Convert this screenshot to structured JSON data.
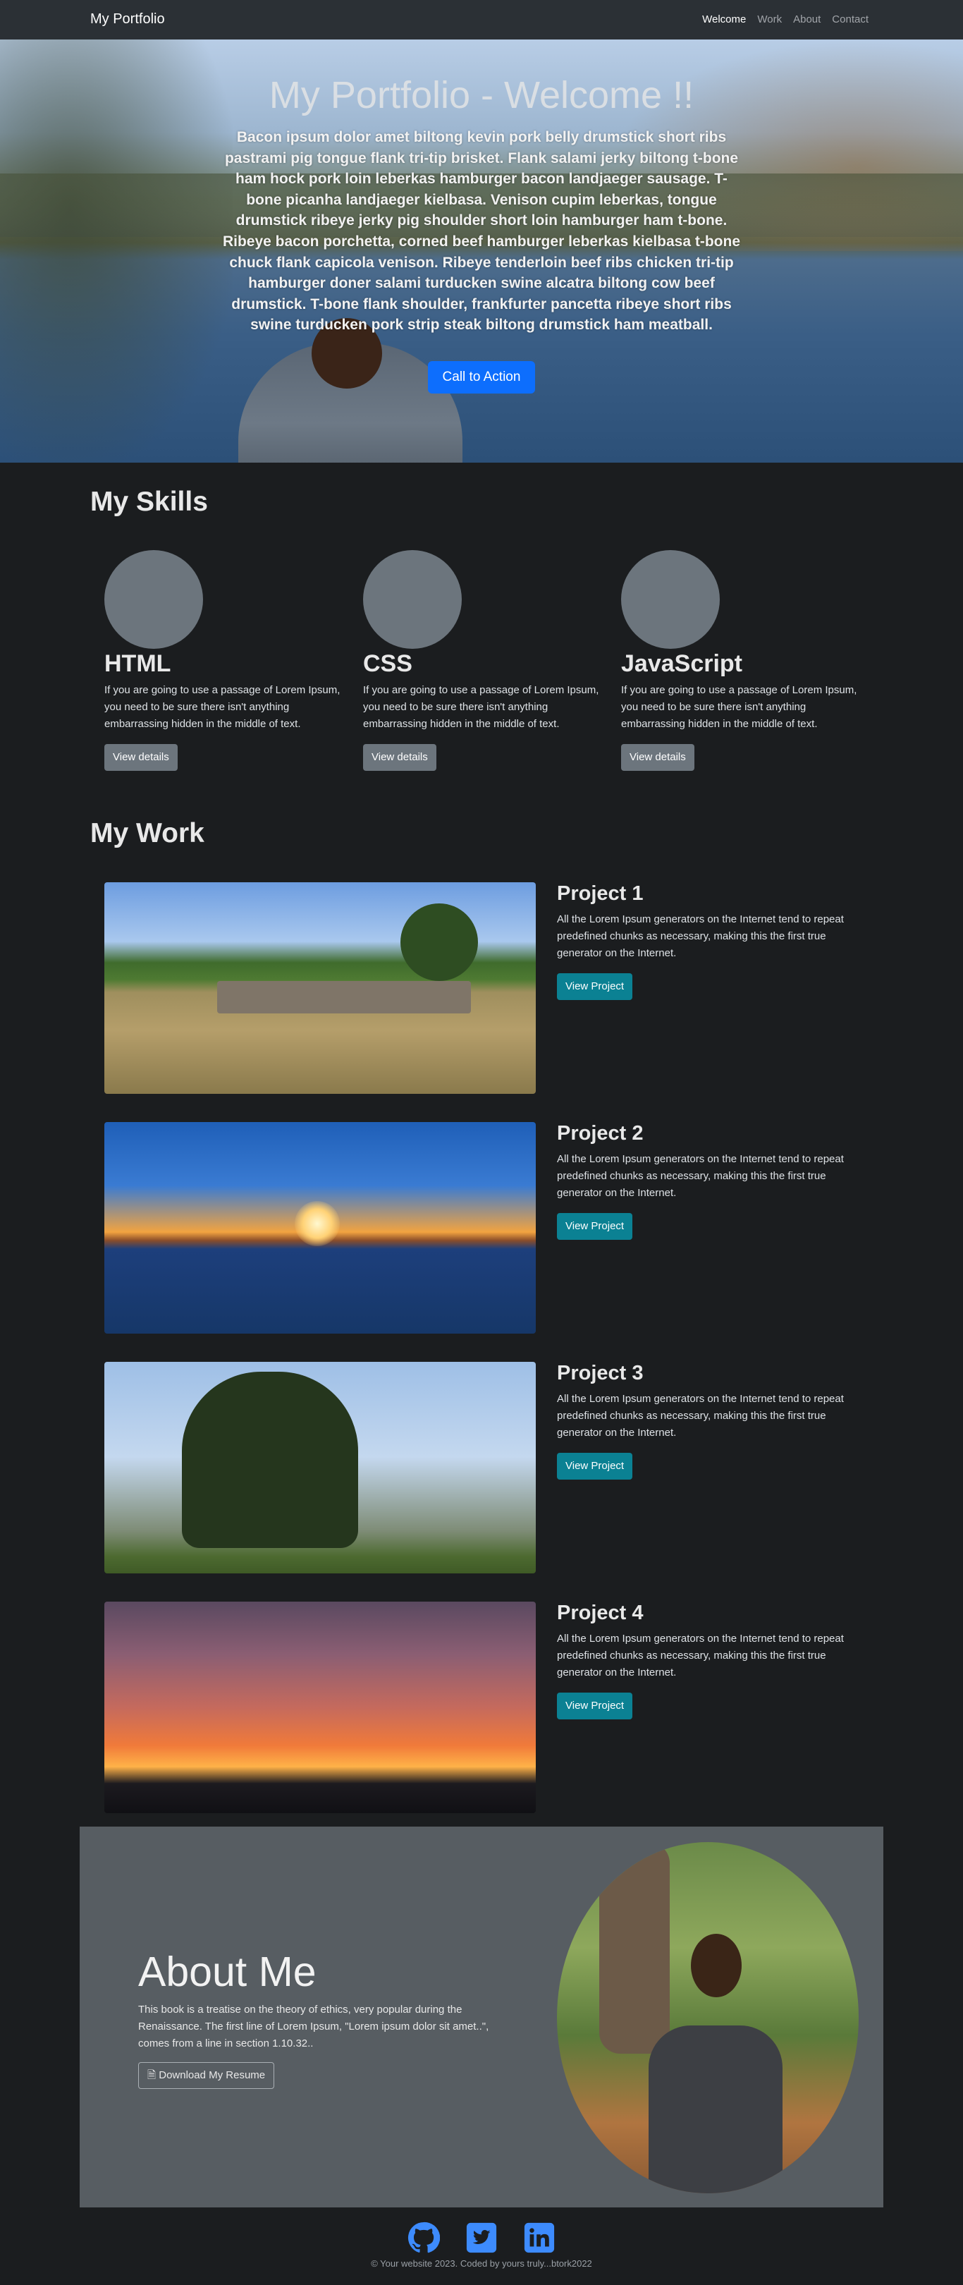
{
  "nav": {
    "brand": "My Portfolio",
    "links": [
      {
        "label": "Welcome",
        "active": true
      },
      {
        "label": "Work",
        "active": false
      },
      {
        "label": "About",
        "active": false
      },
      {
        "label": "Contact",
        "active": false
      }
    ]
  },
  "hero": {
    "title": "My Portfolio - Welcome !!",
    "text": "Bacon ipsum dolor amet biltong kevin pork belly drumstick short ribs pastrami pig tongue flank tri-tip brisket. Flank salami jerky biltong t-bone ham hock pork loin leberkas hamburger bacon landjaeger sausage. T-bone picanha landjaeger kielbasa. Venison cupim leberkas, tongue drumstick ribeye jerky pig shoulder short loin hamburger ham t-bone. Ribeye bacon porchetta, corned beef hamburger leberkas kielbasa t-bone chuck flank capicola venison. Ribeye tenderloin beef ribs chicken tri-tip hamburger doner salami turducken swine alcatra biltong cow beef drumstick. T-bone flank shoulder, frankfurter pancetta ribeye short ribs swine turducken pork strip steak biltong drumstick ham meatball.",
    "cta": "Call to Action"
  },
  "skills": {
    "title": "My Skills",
    "items": [
      {
        "name": "HTML",
        "text": "If you are going to use a passage of Lorem Ipsum, you need to be sure there isn't anything embarrassing hidden in the middle of text.",
        "button": "View details"
      },
      {
        "name": "CSS",
        "text": "If you are going to use a passage of Lorem Ipsum, you need to be sure there isn't anything embarrassing hidden in the middle of text.",
        "button": "View details"
      },
      {
        "name": "JavaScript",
        "text": "If you are going to use a passage of Lorem Ipsum, you need to be sure there isn't anything embarrassing hidden in the middle of text.",
        "button": "View details"
      }
    ]
  },
  "work": {
    "title": "My Work",
    "projects": [
      {
        "name": "Project 1",
        "text": "All the Lorem Ipsum generators on the Internet tend to repeat predefined chunks as necessary, making this the first true generator on the Internet.",
        "button": "View Project"
      },
      {
        "name": "Project 2",
        "text": "All the Lorem Ipsum generators on the Internet tend to repeat predefined chunks as necessary, making this the first true generator on the Internet.",
        "button": "View Project"
      },
      {
        "name": "Project 3",
        "text": "All the Lorem Ipsum generators on the Internet tend to repeat predefined chunks as necessary, making this the first true generator on the Internet.",
        "button": "View Project"
      },
      {
        "name": "Project 4",
        "text": "All the Lorem Ipsum generators on the Internet tend to repeat predefined chunks as necessary, making this the first true generator on the Internet.",
        "button": "View Project"
      }
    ]
  },
  "about": {
    "title": "About Me",
    "text": "This book is a treatise on the theory of ethics, very popular during the Renaissance. The first line of Lorem Ipsum, \"Lorem ipsum dolor sit amet..\", comes from a line in section 1.10.32..",
    "button": "Download My Resume"
  },
  "footer": {
    "icons": [
      "github-icon",
      "twitter-icon",
      "linkedin-icon"
    ],
    "copyright": "© Your website 2023. Coded by yours truly...btork2022"
  },
  "colors": {
    "primary": "#0d6efd",
    "teal": "#0b8193",
    "icon_blue": "#3d8bfd",
    "background": "#1b1d1f"
  }
}
